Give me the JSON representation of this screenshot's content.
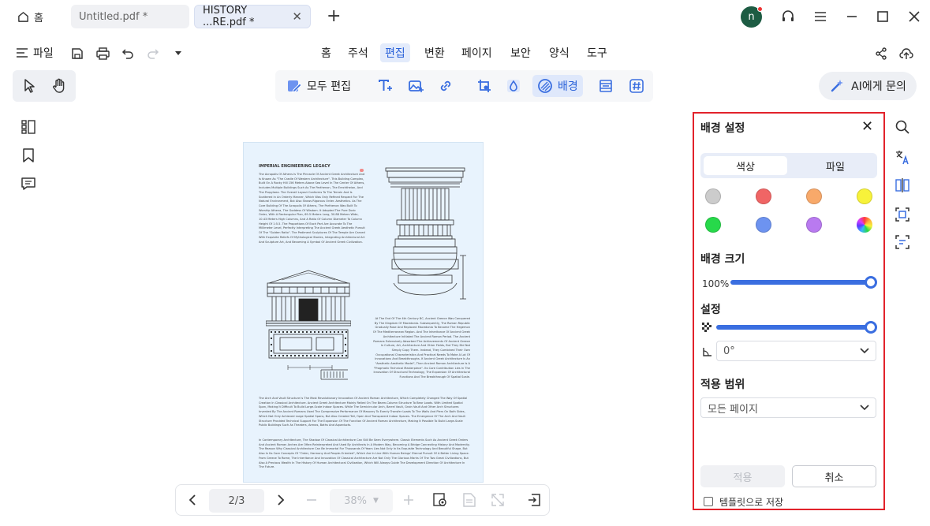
{
  "tabs": {
    "home_label": "홈",
    "untitled_label": "Untitled.pdf *",
    "active_label": "HISTORY ...RE.pdf *",
    "avatar_initial": "n"
  },
  "menubar": {
    "file_label": "파일",
    "items": [
      "홈",
      "주석",
      "편집",
      "변환",
      "페이지",
      "보안",
      "양식",
      "도구"
    ],
    "active_index": 2
  },
  "toolbar": {
    "edit_all_label": "모두 편집",
    "background_label": "배경",
    "ai_label": "AI에게 문의"
  },
  "document": {
    "title": "IMPERIAL ENGINEERING LEGACY",
    "para1": "The Acropolis Of Athens Is The Pinnacle Of Ancient Greek Architecture And Is Known As \"The Cradle Of Western Architecture\". This Building Complex, Built On A Rocky Hill 156 Meters Above Sea Level In The Center Of Athens, Includes Multiple Buildings Such As The Parthenon, The Erechtheion, And The Propylaea. The Overall Layout Conforms To The Terrain And Is Scattered In An Orderly Manner, Which Was Only Refined Respect For The Natural Environment, But Also Shows Rigorous Order. Aesthetics. As The Core Building Of The Acropolis Of Athens, The Parthenon Was Built To Worship Athena, The Goddess Of Wisdom. It Adopted The Pure Doric Order, With A Rectangular Plan, 69.5 Meters Long, 30.88 Meters Wide, 10.43 Meters High Columns, And A Ratio Of Column Diameter To Column Height Of 1:5.5. The Proportions Of Each Part Are Accurate To The Millimeter Level, Perfectly Interpreting The Ancient Greek Aesthetic Pursuit Of The \"Golden Ratio\". The Pediment Sculptures Of The Temple Are Carved With Exquisite Reliefs Of Mythological Stories, Integrating Architectural Art And Sculpture Art, And Becoming A Symbol Of Ancient Greek Civilization.",
    "para2": "At The End Of The 4th Century BC, Ancient Greece Was Conquered By The Kingdom Of Macedonia. Subsequently, The Roman Republic Gradually Rose And Replaced Macedonia To Become The Hegemon Of The Mediterranean Region. And The Inheritance Of Ancient Greek Architecture Initiated The Ancient Roman Period. The Ancient Romans Extensively Absorbed The Achievements Of Ancient Greece In Culture, Art, Architecture And Other Fields, But They Did Not Simply Copy Them. Instead, They Combined Their Own Occupational Characteristics And Practical Needs To Make A Lot Of Innovations And Breakthroughs. If Ancient Greek Architecture Is An \"Aesthetic Aesthetic Model\", Then Ancient Roman Architecture Is A \"Pragmatic Technical Masterpiece\". Its Core Contribution Lies In The Innovation Of Structural Technology, The Expansion Of Architectural Functions And The Breakthrough Of Spatial Scale.",
    "para3": "The Arch And Vault Structure Is The Most Revolutionary Innovation Of Ancient Roman Architecture, Which Completely Changed The Way Of Spatial Creation In Classical Architecture. Ancient Greek Architecture Mainly Relied On The Beam-Column Structure To Bear Loads. With Limited Spatial Span, Making It Difficult To Build Large-Scale Indoor Spaces. While The Semicircular Arch, Barrel Vault, Groin Vault And Other Arch Structures Invented By The Ancient Romans Used The Compressive Performance Of Masonry To Evenly Transfer Loads To The Walls And Piers On Both Sides, Which Not Only Achieved Large Spatial Spans, But Also Created Tall, Open And Transparent Indoor Spaces. The Emergence Of The Arch And Vault Structure Provided Technical Support For The Expansion Of The Function Of Ancient Roman Architecture, Making It Possible To Build Large-Scale Public Buildings Such As Theaters, Arenas, Baths And Aqueducts.",
    "para4": "In Contemporary Architecture, The Shadow Of Classical Architecture Can Still Be Seen Everywhere. Classic Elements Such As Ancient Greek Orders And Ancient Roman Arches Are Often Reinterpreted And Used By Architects In A Modern Way, Becoming A Bridge Connecting History And Modernity. The Reason Why Classical Architecture Can Be Immortal For Thousands Of Years Lies Not Only In Its Exquisite Technology And Beautiful Shape, But Also In Its Core Concepts Of \"Order, Harmony And People-Oriented\", Which Are In Line With Human Beings' Eternal Pursuit Of A Better Living Space. From Greece To Rome, The Inheritance And Innovation Of Classical Architecture Are Not Only The Glorious Marks Of The Two Great Civilizations, But Also A Precious Wealth In The History Of Human Architectural Civilization, Which Will Always Guide The Development Direction Of Architecture In The Future."
  },
  "bottombar": {
    "page_indicator": "2/3",
    "zoom_level": "38%"
  },
  "panel": {
    "title": "배경 설정",
    "tab_color": "색상",
    "tab_file": "파일",
    "swatches": [
      "#cccccc",
      "#f06565",
      "#f8a96a",
      "#f7f23a",
      "#27d94a",
      "#6d93f0",
      "#b97af0",
      "rainbow"
    ],
    "size_label": "배경 크기",
    "size_value": "100%",
    "size_fraction": 1.0,
    "settings_label": "설정",
    "opacity_fraction": 1.0,
    "rotation_value": "0°",
    "scope_label": "적용 범위",
    "scope_value": "모든 페이지",
    "apply_label": "적용",
    "cancel_label": "취소",
    "save_template_label": "템플릿으로 저장"
  },
  "colors": {
    "accent": "#3a6ee0",
    "panel_border": "#e2222b",
    "page_bg": "#e8f3fd"
  }
}
